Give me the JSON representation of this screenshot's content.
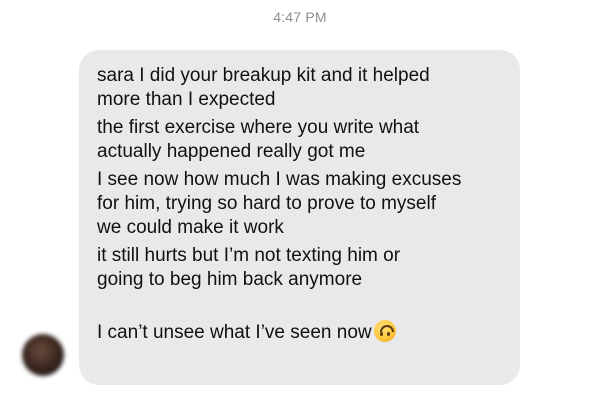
{
  "header": {
    "timestamp": "4:47 PM"
  },
  "avatar": {
    "icon": "blurred-contact-avatar"
  },
  "message": {
    "lines": [
      "sara I did your breakup kit and it helped\nmore than I expected",
      "the first exercise where you write what\nactually happened really got me",
      "I see now how much I was making excuses\nfor him, trying so hard to prove to myself\nwe could make it work",
      "it still hurts but I’m not texting him or\ngoing to beg him back anymore",
      "I can’t unsee what I’ve seen now"
    ],
    "trailing_emoji": "upside-down-face-emoji"
  },
  "colors": {
    "bubble": "#e9e9eb",
    "timestamp": "#8e8e93",
    "text": "#111111"
  }
}
